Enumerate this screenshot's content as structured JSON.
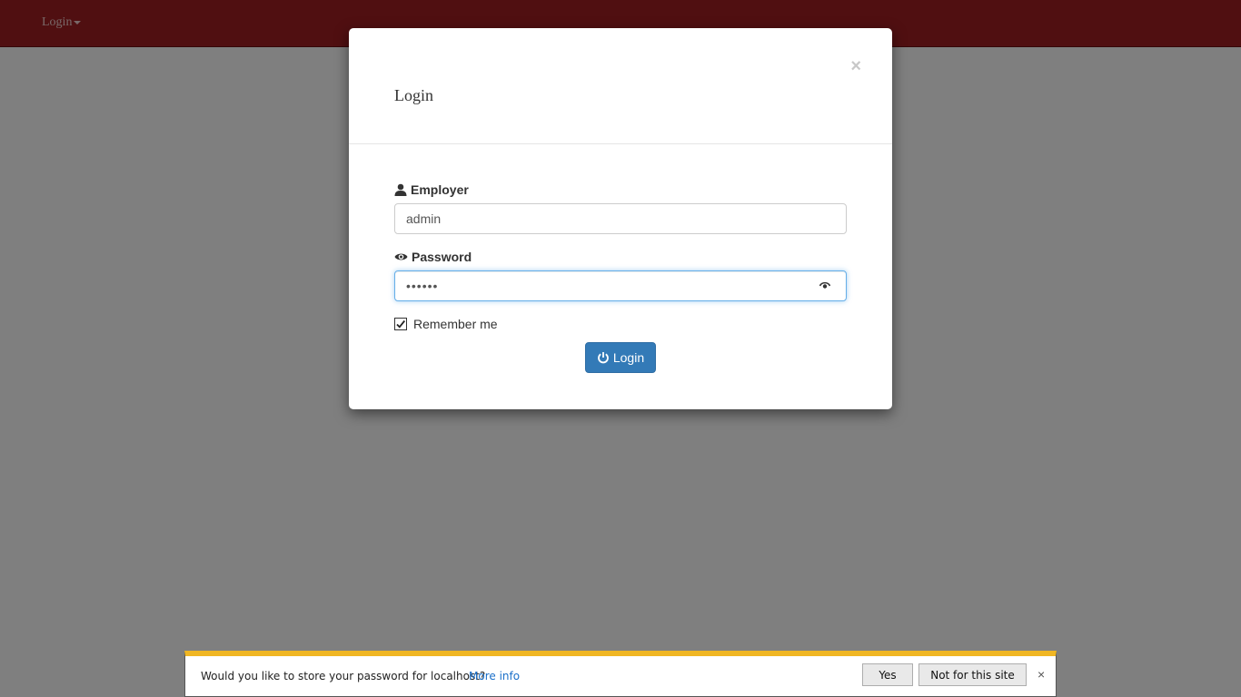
{
  "navbar": {
    "login_label": "Login",
    "background": "#a01e22"
  },
  "modal": {
    "title": "Login",
    "close_glyph": "×",
    "employer": {
      "label": "Employer",
      "value": "admin",
      "icon": "user-icon"
    },
    "password": {
      "label": "Password",
      "value": "••••••",
      "icon": "eye-icon",
      "reveal_icon": "eye-reveal-icon"
    },
    "remember": {
      "label": "Remember me",
      "checked": true
    },
    "submit": {
      "label": "Login",
      "icon": "power-icon",
      "color": "#337ab7"
    }
  },
  "password_prompt": {
    "message": "Would you like to store your password for localhost?",
    "more_info": "More info",
    "yes_label": "Yes",
    "not_for_site_label": "Not for this site",
    "close_glyph": "×",
    "accent": "#f0b623"
  }
}
